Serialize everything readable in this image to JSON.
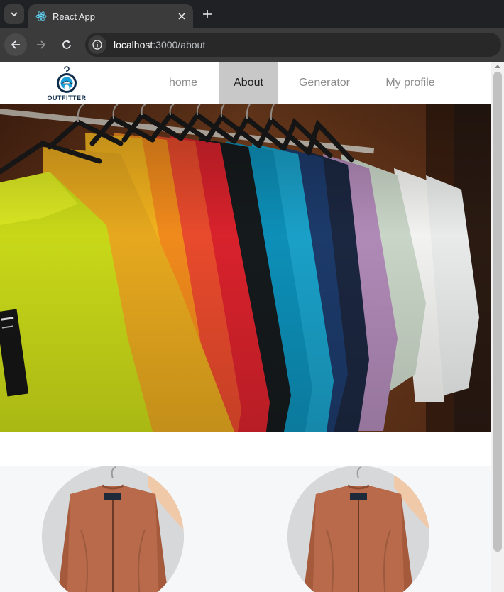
{
  "browser": {
    "tab_title": "React App",
    "url_host": "localhost",
    "url_path": ":3000/about"
  },
  "site": {
    "logo_text": "OUTFITTER",
    "nav": [
      {
        "label": "home",
        "active": false
      },
      {
        "label": "About",
        "active": true
      },
      {
        "label": "Generator",
        "active": false
      },
      {
        "label": "My profile",
        "active": false
      }
    ]
  },
  "icons": {
    "tab_search": "chevron-down-icon",
    "favicon": "react-icon",
    "tab_close": "close-icon",
    "new_tab": "plus-icon",
    "back": "arrow-left-icon",
    "forward": "arrow-right-icon",
    "reload": "reload-icon",
    "site_info": "info-icon"
  },
  "colors": {
    "active_nav_bg": "#c8c8c8",
    "nav_text": "#8c8c8c",
    "logo_navy": "#0f2d4a",
    "product_jacket": "#b86a4a"
  }
}
